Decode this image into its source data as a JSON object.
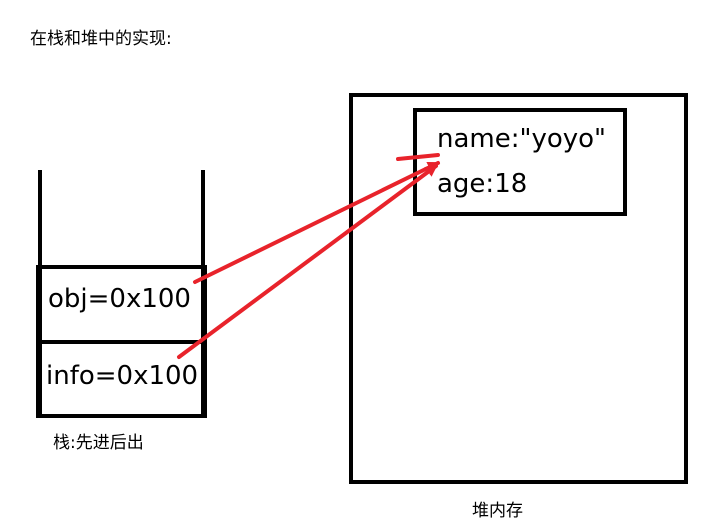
{
  "title": "在栈和堆中的实现:",
  "stack": {
    "cells": [
      {
        "text": "obj=0x100"
      },
      {
        "text": "info=0x100"
      }
    ],
    "caption": "栈:先进后出"
  },
  "heap": {
    "caption": "堆内存",
    "object": {
      "lines": [
        "name:\"yoyo\"",
        "age:18"
      ]
    }
  },
  "colors": {
    "outline": "#000000",
    "arrow": "#e8232b"
  }
}
